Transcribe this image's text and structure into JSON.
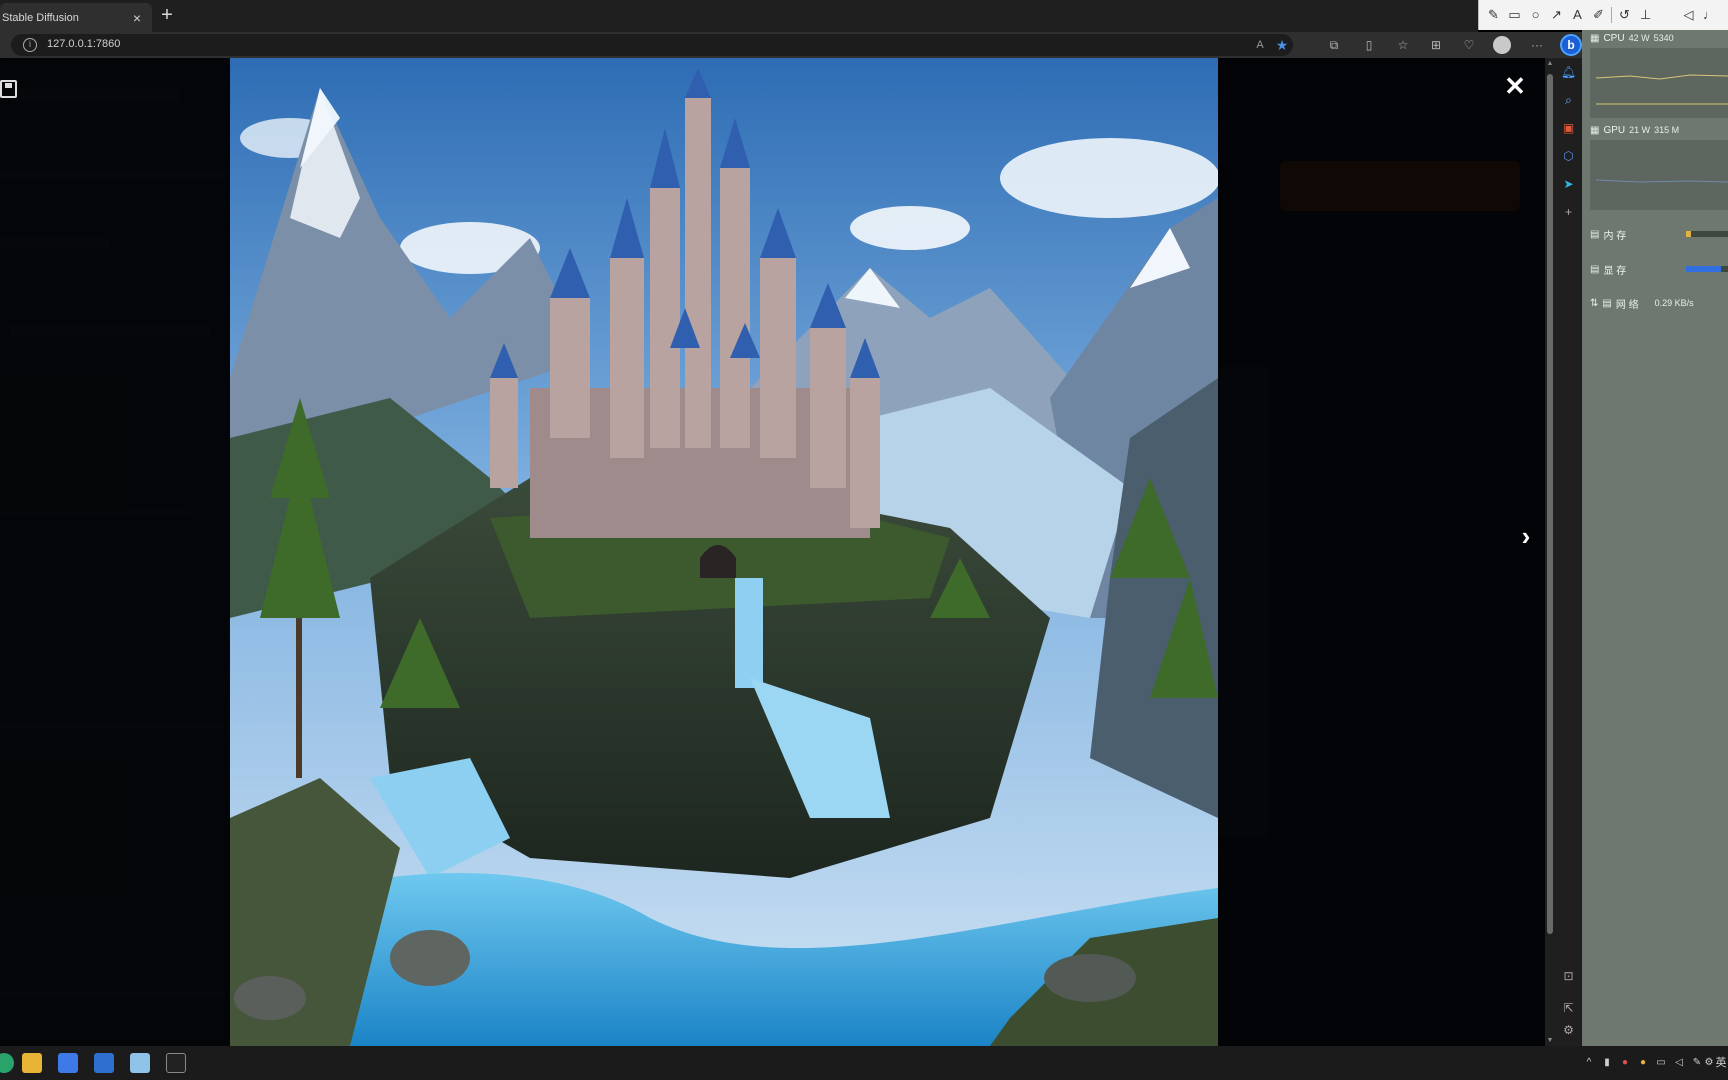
{
  "browser": {
    "tab_title": "Stable Diffusion",
    "tab_close": "×",
    "new_tab": "+",
    "url": "127.0.0.1:7860",
    "more_menu": "···"
  },
  "lightbox": {
    "close_glyph": "✕",
    "next_glyph": "›"
  },
  "monitor": {
    "cpu_label": "CPU",
    "cpu_power": "42 W",
    "cpu_freq": "5340",
    "gpu_label": "GPU",
    "gpu_power": "21 W",
    "gpu_freq": "315 M",
    "mem_label": "内 存",
    "vram_label": "显 存",
    "net_label": "网 络",
    "net_value": "0.29 KB/s",
    "mem_fill": 0.11,
    "vram_fill": 0.83
  },
  "taskbar": {
    "ime": "英"
  },
  "colors": {
    "accent": "#1a5fd6",
    "monitor_bg": "#6e786f",
    "mem_bar": "#e3b341",
    "vram_bar": "#2f6fe0"
  }
}
